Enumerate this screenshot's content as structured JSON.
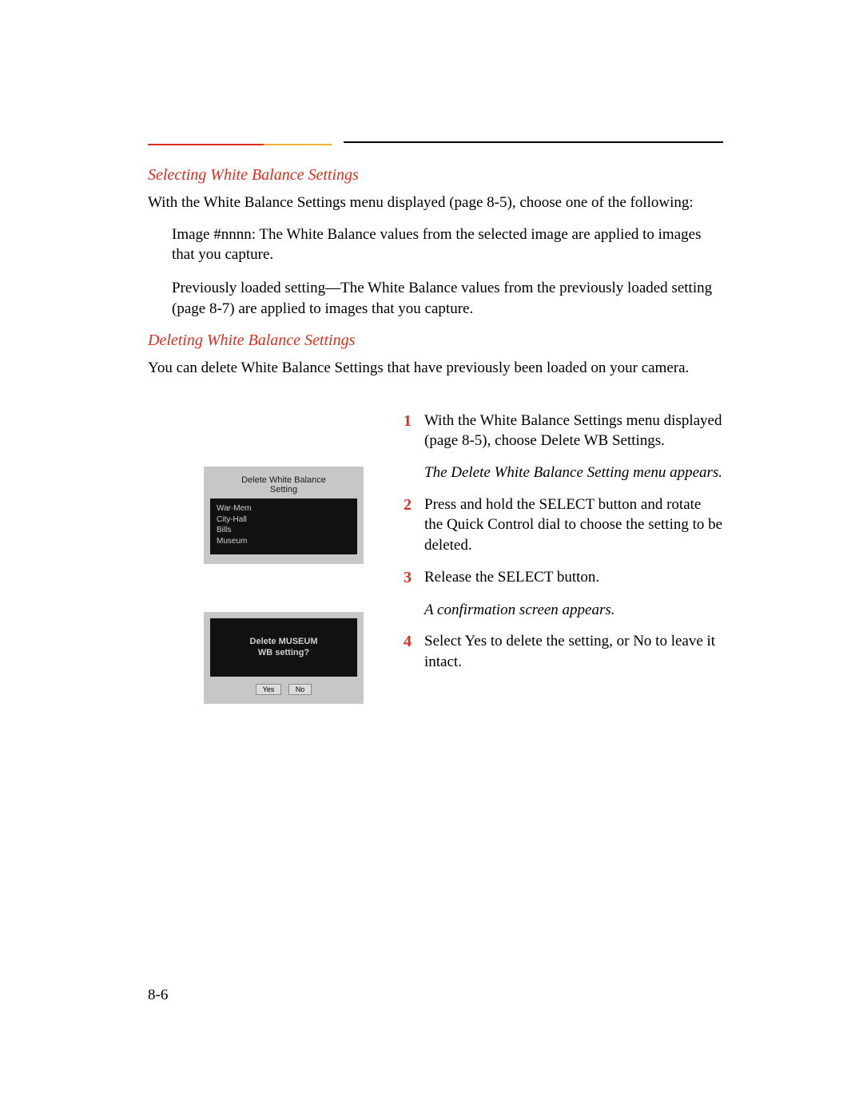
{
  "section1": {
    "heading": "Selecting White Balance Settings",
    "intro": "With the White Balance Settings menu displayed (page 8-5), choose one of the following:",
    "bullets": [
      "Image #nnnn: The White Balance values from the selected image are applied to images that you capture.",
      "Previously loaded setting—The White Balance values from the previously loaded setting (page 8-7) are applied to images that you capture."
    ]
  },
  "section2": {
    "heading": "Deleting White Balance Settings",
    "intro": "You can delete White Balance Settings that have previously been loaded on your camera."
  },
  "screenshot1": {
    "title_line1": "Delete White Balance",
    "title_line2": "Setting",
    "items": [
      "War-Mem",
      "City-Hall",
      "Bills",
      "Museum"
    ]
  },
  "screenshot2": {
    "line1": "Delete MUSEUM",
    "line2": "WB setting?",
    "yes": "Yes",
    "no": "No"
  },
  "steps": [
    {
      "num": "1",
      "text": "With the White Balance Settings menu displayed (page 8-5), choose Delete WB Settings."
    },
    {
      "num": "2",
      "text": "Press and hold the SELECT button and rotate the Quick Control dial to choose the setting to be deleted."
    },
    {
      "num": "3",
      "text": "Release the SELECT button."
    },
    {
      "num": "4",
      "text": "Select Yes to delete the setting, or No to leave it intact."
    }
  ],
  "results": {
    "after1": "The Delete White Balance Setting menu appears.",
    "after3": "A confirmation screen appears."
  },
  "page_number": "8-6"
}
